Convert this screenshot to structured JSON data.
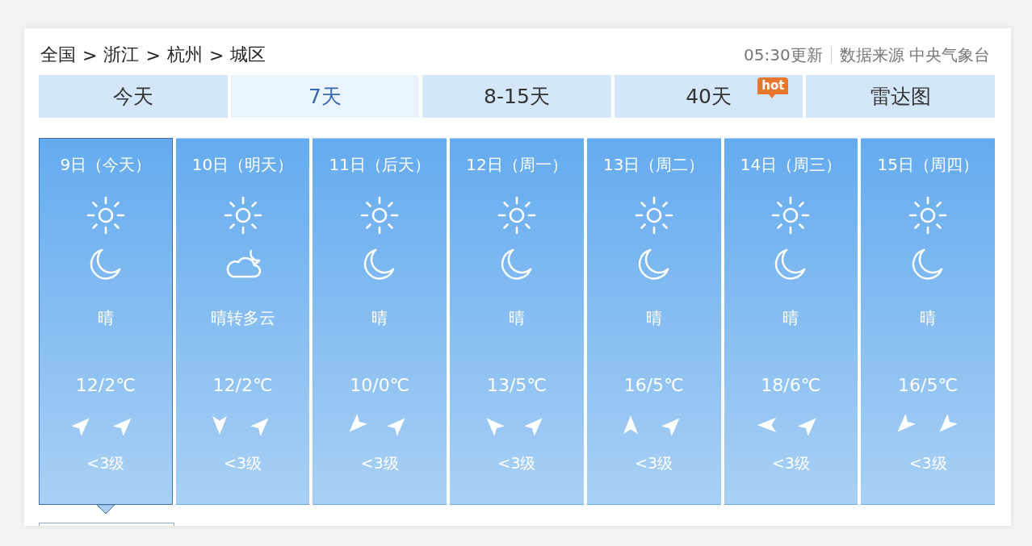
{
  "breadcrumb": {
    "items": [
      "全国",
      "浙江",
      "杭州",
      "城区"
    ],
    "separators": [
      ">",
      ">",
      ">"
    ]
  },
  "update": {
    "time": "05:30更新",
    "source": "数据来源 中央气象台"
  },
  "tabs": [
    {
      "label": "今天",
      "selected": false
    },
    {
      "label": "7天",
      "selected": true
    },
    {
      "label": "8-15天",
      "selected": false
    },
    {
      "label": "40天",
      "selected": false,
      "badge": "hot"
    },
    {
      "label": "雷达图",
      "selected": false
    }
  ],
  "days": [
    {
      "date": "9日（今天）",
      "selected": true,
      "day_icon": {
        "kind": "sun"
      },
      "night_icon": {
        "kind": "moon"
      },
      "weather": "晴",
      "temp": "12/2℃",
      "wind_arrows": [
        {
          "kind": "ne"
        },
        {
          "kind": "ne"
        }
      ],
      "wind_level": "<3级"
    },
    {
      "date": "10日（明天）",
      "selected": false,
      "day_icon": {
        "kind": "sun"
      },
      "night_icon": {
        "kind": "cloudmoon"
      },
      "weather": "晴转多云",
      "temp": "12/2℃",
      "wind_arrows": [
        {
          "kind": "s"
        },
        {
          "kind": "ne"
        }
      ],
      "wind_level": "<3级"
    },
    {
      "date": "11日（后天）",
      "selected": false,
      "day_icon": {
        "kind": "sun"
      },
      "night_icon": {
        "kind": "moon"
      },
      "weather": "晴",
      "temp": "10/0℃",
      "wind_arrows": [
        {
          "kind": "sw"
        },
        {
          "kind": "ne"
        }
      ],
      "wind_level": "<3级"
    },
    {
      "date": "12日（周一）",
      "selected": false,
      "day_icon": {
        "kind": "sun"
      },
      "night_icon": {
        "kind": "moon"
      },
      "weather": "晴",
      "temp": "13/5℃",
      "wind_arrows": [
        {
          "kind": "nw"
        },
        {
          "kind": "ne"
        }
      ],
      "wind_level": "<3级"
    },
    {
      "date": "13日（周二）",
      "selected": false,
      "day_icon": {
        "kind": "sun"
      },
      "night_icon": {
        "kind": "moon"
      },
      "weather": "晴",
      "temp": "16/5℃",
      "wind_arrows": [
        {
          "kind": "n"
        },
        {
          "kind": "ne"
        }
      ],
      "wind_level": "<3级"
    },
    {
      "date": "14日（周三）",
      "selected": false,
      "day_icon": {
        "kind": "sun"
      },
      "night_icon": {
        "kind": "moon"
      },
      "weather": "晴",
      "temp": "18/6℃",
      "wind_arrows": [
        {
          "kind": "w"
        },
        {
          "kind": "ne"
        }
      ],
      "wind_level": "<3级"
    },
    {
      "date": "15日（周四）",
      "selected": false,
      "day_icon": {
        "kind": "sun"
      },
      "night_icon": {
        "kind": "moon"
      },
      "weather": "晴",
      "temp": "16/5℃",
      "wind_arrows": [
        {
          "kind": "sw"
        },
        {
          "kind": "sw"
        }
      ],
      "wind_level": "<3级"
    }
  ]
}
